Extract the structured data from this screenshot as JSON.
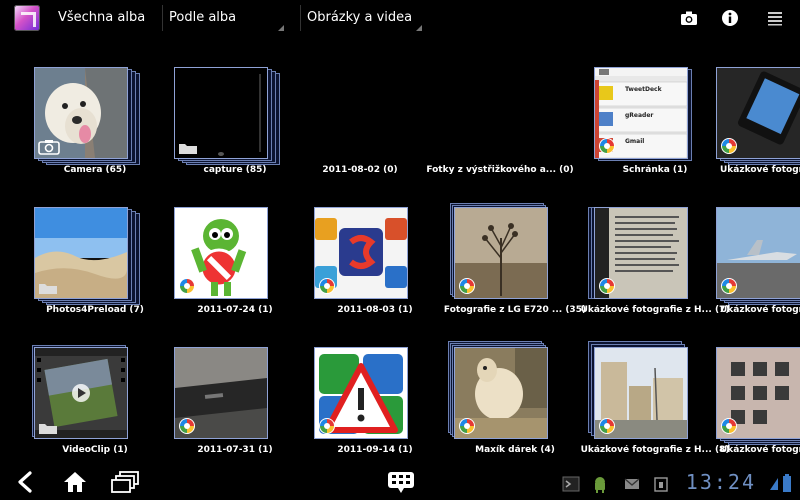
{
  "actionbar": {
    "title": "Všechna alba",
    "group_by": "Podle alba",
    "media_filter": "Obrázky a videa"
  },
  "albums": [
    {
      "label": "Camera (65)"
    },
    {
      "label": "capture (85)"
    },
    {
      "label": "2011-08-02 (0)"
    },
    {
      "label": "Fotky z výstřižkového a... (0)"
    },
    {
      "label": "Schránka (1)"
    },
    {
      "label": "Ukázkové fotografie"
    },
    {
      "label": "Photos4Preload (7)"
    },
    {
      "label": "2011-07-24 (1)"
    },
    {
      "label": "2011-08-03 (1)"
    },
    {
      "label": "Fotografie z LG E720 ... (35)"
    },
    {
      "label": "Ukázkové fotografie z H... (7)"
    },
    {
      "label": "Ukázkové fotografie"
    },
    {
      "label": "VideoClip (1)"
    },
    {
      "label": "2011-07-31 (1)"
    },
    {
      "label": "2011-09-14 (1)"
    },
    {
      "label": "Maxík dárek (4)"
    },
    {
      "label": "Ukázkové fotografie z H... (8)"
    },
    {
      "label": "Ukázkové fotografie"
    }
  ],
  "clipboard_items": [
    "TweetDeck",
    "gReader",
    "Gmail"
  ],
  "statusbar": {
    "clock": "13:24"
  },
  "icons": {
    "back": "back-arrow-icon",
    "home": "home-icon",
    "recents": "recent-apps-icon",
    "apps": "apps-grid-icon",
    "camera": "camera-icon",
    "info": "info-icon",
    "menu": "menu-icon"
  }
}
